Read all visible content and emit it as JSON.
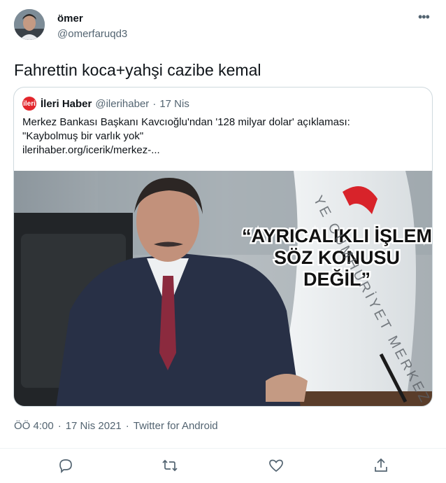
{
  "author": {
    "name": "ömer",
    "handle": "@omerfaruqd3"
  },
  "tweet": {
    "text": "Fahrettin koca+yahşi cazibe kemal"
  },
  "quoted": {
    "logo_text": "ileri",
    "name": "İleri Haber",
    "handle": "@ilerihaber",
    "dot": "·",
    "date": "17 Nis",
    "lines": [
      "Merkez Bankası Başkanı Kavcıoğlu'ndan '128 milyar dolar' açıklaması:",
      "\"Kaybolmuş bir varlık yok\"",
      "ilerihaber.org/icerik/merkez-..."
    ],
    "image_caption": [
      "“AYRICALIKLI İŞLEM",
      "SÖZ KONUSU",
      "DEĞİL”"
    ],
    "flag_text": "YE CUMHURİYET MERKEZ BANKASI"
  },
  "meta": {
    "time": "ÖÖ 4:00",
    "sep": "·",
    "date": "17 Nis 2021",
    "source": "Twitter for Android"
  },
  "more_label": "•••",
  "colors": {
    "text": "#0f1419",
    "muted": "#536471",
    "border": "#cfd9de",
    "brand_red": "#e3262c"
  },
  "icons": [
    "reply-icon",
    "retweet-icon",
    "like-icon",
    "share-icon"
  ]
}
